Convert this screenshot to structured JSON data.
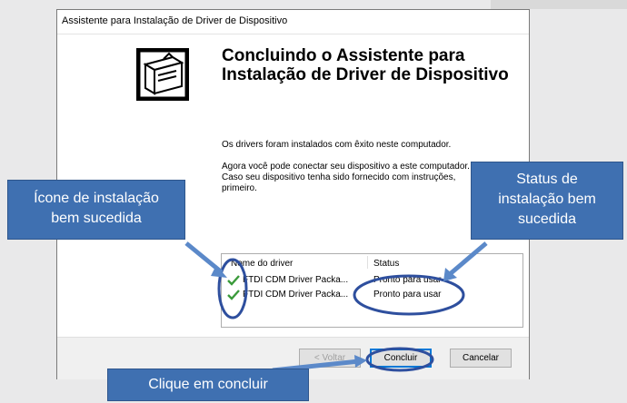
{
  "dialog": {
    "title": "Assistente para Instalação de Driver de Dispositivo",
    "heading_line1": "Concluindo o Assistente para",
    "heading_line2": "Instalação de Driver de Dispositivo",
    "para1": "Os drivers foram instalados com êxito neste computador.",
    "para2_line1": "Agora você pode conectar seu dispositivo a este computador.",
    "para2_line2": "Caso seu dispositivo tenha sido fornecido com instruções,",
    "para2_line3": "primeiro."
  },
  "table": {
    "header_driver": "Nome do driver",
    "header_status": "Status",
    "rows": [
      {
        "driver": "FTDI CDM Driver Packa...",
        "status": "Pronto para usar"
      },
      {
        "driver": "FTDI CDM Driver Packa...",
        "status": "Pronto para usar"
      }
    ]
  },
  "buttons": {
    "back": "< Voltar",
    "finish": "Concluir",
    "cancel": "Cancelar"
  },
  "callouts": {
    "icon_note_line1": "Ícone de instalação",
    "icon_note_line2": "bem sucedida",
    "status_note_line1": "Status de",
    "status_note_line2": "instalação bem",
    "status_note_line3": "sucedida",
    "click_note": "Clique em concluir"
  },
  "colors": {
    "callout_blue": "#3f70b1",
    "annotation_ring": "#2e4f9e",
    "check_green": "#3a9a3a"
  }
}
